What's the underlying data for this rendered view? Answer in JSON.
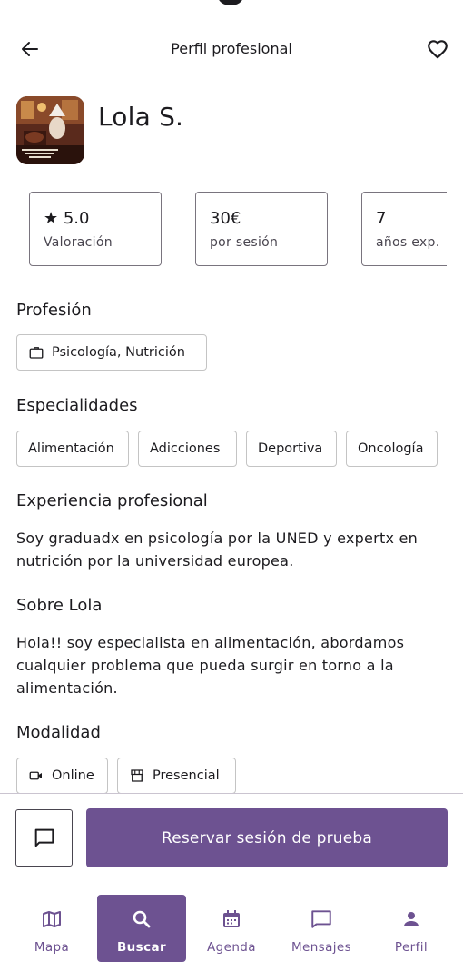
{
  "colors": {
    "accent": "#6d5291",
    "on_accent": "#ffffff",
    "text": "#1c1b1f",
    "text_secondary": "#49454f",
    "outline": "#79747e",
    "chip_outline": "#c4c4c4"
  },
  "header": {
    "title": "Perfil profesional",
    "back_icon": "arrow-left-icon",
    "favorite_icon": "heart-outline-icon"
  },
  "profile": {
    "name": "Lola S."
  },
  "stats": [
    {
      "value": "★ 5.0",
      "label": "Valoración"
    },
    {
      "value": "30€",
      "label": "por sesión"
    },
    {
      "value": "7",
      "label": "años exp."
    }
  ],
  "profession": {
    "title": "Profesión",
    "chip_label": "Psicología, Nutrición",
    "chip_icon": "briefcase-icon"
  },
  "specialties": {
    "title": "Especialidades",
    "items": [
      "Alimentación",
      "Adicciones",
      "Deportiva",
      "Oncología"
    ]
  },
  "experience": {
    "title": "Experiencia profesional",
    "text": "Soy graduadx en psicología por la UNED y expertx en nutrición por la universidad europea."
  },
  "about": {
    "title": "Sobre Lola",
    "text": "Hola!! soy especialista en alimentación, abordamos cualquier problema que pueda surgir en torno a la alimentación."
  },
  "modality": {
    "title": "Modalidad",
    "items": [
      {
        "label": "Online",
        "icon": "video-camera-icon"
      },
      {
        "label": "Presencial",
        "icon": "storefront-icon"
      }
    ]
  },
  "actions": {
    "chat_icon": "chat-bubble-icon",
    "reserve_label": "Reservar sesión de prueba"
  },
  "bottom_nav": {
    "active": "Buscar",
    "items": [
      {
        "label": "Mapa",
        "icon": "map-icon"
      },
      {
        "label": "Buscar",
        "icon": "search-icon"
      },
      {
        "label": "Agenda",
        "icon": "calendar-icon"
      },
      {
        "label": "Mensajes",
        "icon": "message-icon"
      },
      {
        "label": "Perfil",
        "icon": "person-icon"
      }
    ]
  }
}
